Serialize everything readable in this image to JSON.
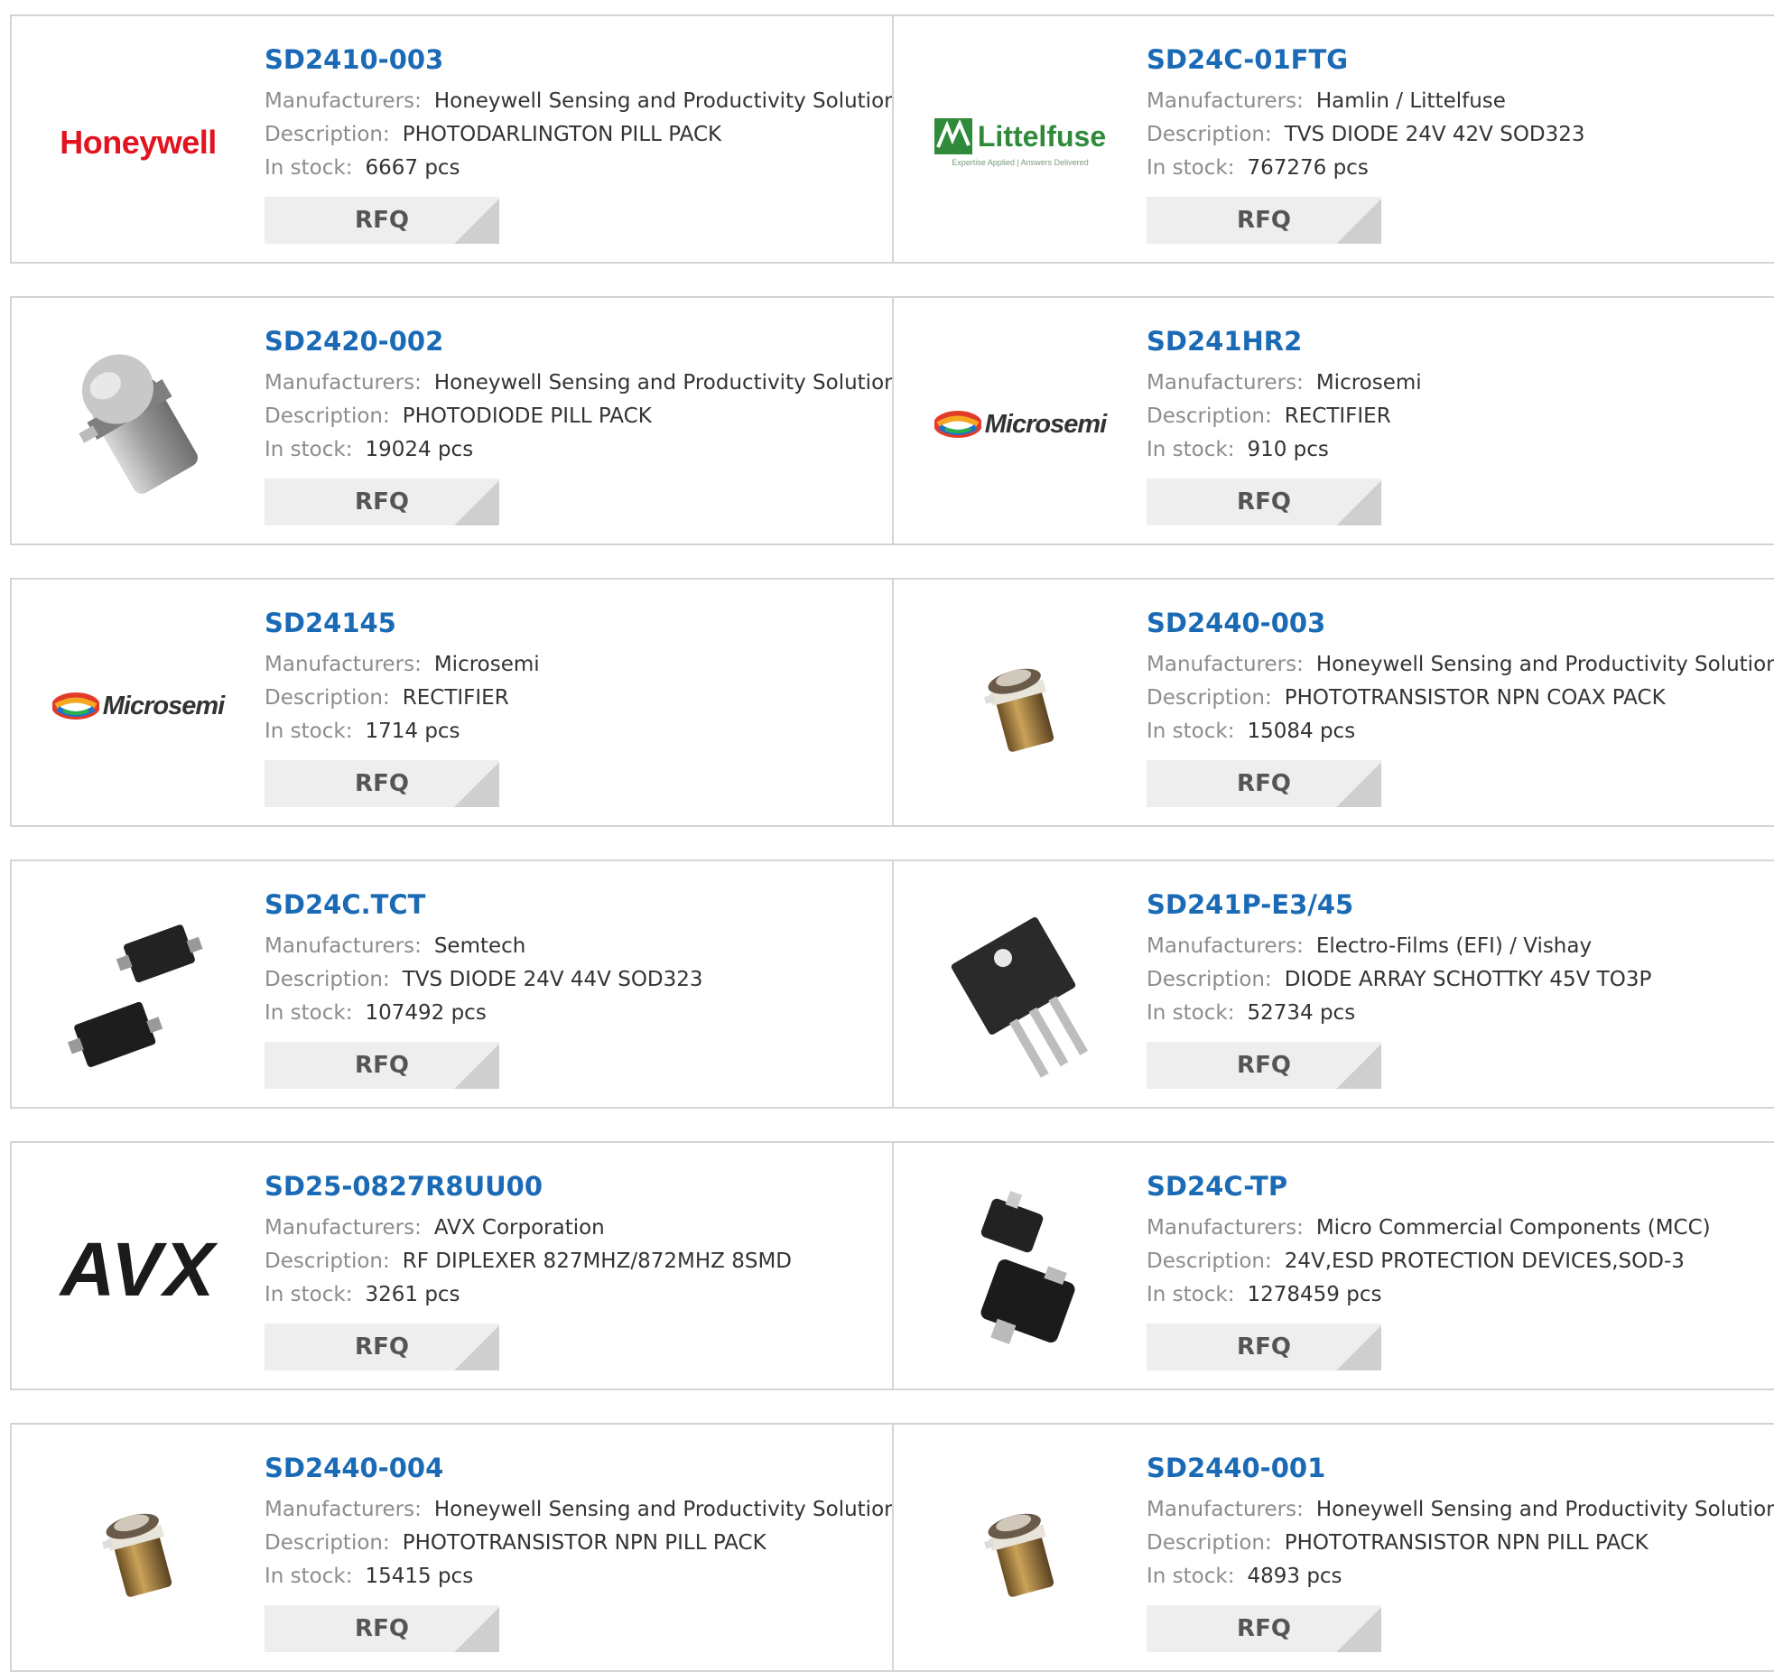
{
  "labels": {
    "manufacturers": "Manufacturers:",
    "description": "Description:",
    "in_stock": "In stock:",
    "rfq": "RFQ"
  },
  "colors": {
    "part_link": "#1a6ab5",
    "card_border": "#d4d4d4",
    "rfq_bg": "#eeeeee"
  },
  "products": [
    {
      "part": "SD2410-003",
      "manufacturer": "Honeywell Sensing and Productivity Solutions",
      "description": "PHOTODARLINGTON PILL PACK",
      "stock": "6667 pcs",
      "image": "honeywell-logo",
      "logo_text": "Honeywell"
    },
    {
      "part": "SD24C-01FTG",
      "manufacturer": "Hamlin / Littelfuse",
      "description": "TVS DIODE 24V 42V SOD323",
      "stock": "767276 pcs",
      "image": "littelfuse-logo",
      "logo_text": "Littelfuse",
      "logo_tagline": "Expertise Applied | Answers Delivered"
    },
    {
      "part": "SD2420-002",
      "manufacturer": "Honeywell Sensing and Productivity Solutions",
      "description": "PHOTODIODE PILL PACK",
      "stock": "19024 pcs",
      "image": "photodiode-photo"
    },
    {
      "part": "SD241HR2",
      "manufacturer": "Microsemi",
      "description": "RECTIFIER",
      "stock": "910 pcs",
      "image": "microsemi-logo",
      "logo_text": "Microsemi"
    },
    {
      "part": "SD24145",
      "manufacturer": "Microsemi",
      "description": "RECTIFIER",
      "stock": "1714 pcs",
      "image": "microsemi-logo",
      "logo_text": "Microsemi"
    },
    {
      "part": "SD2440-003",
      "manufacturer": "Honeywell Sensing and Productivity Solutions",
      "description": "PHOTOTRANSISTOR NPN COAX PACK",
      "stock": "15084 pcs",
      "image": "phototransistor-photo"
    },
    {
      "part": "SD24C.TCT",
      "manufacturer": "Semtech",
      "description": "TVS DIODE 24V 44V SOD323",
      "stock": "107492 pcs",
      "image": "sod323-photo"
    },
    {
      "part": "SD241P-E3/45",
      "manufacturer": "Electro-Films (EFI) / Vishay",
      "description": "DIODE ARRAY SCHOTTKY 45V TO3P",
      "stock": "52734 pcs",
      "image": "to3p-photo"
    },
    {
      "part": "SD25-0827R8UU00",
      "manufacturer": "AVX Corporation",
      "description": "RF DIPLEXER 827MHZ/872MHZ 8SMD",
      "stock": "3261 pcs",
      "image": "avx-logo",
      "logo_text": "AVX"
    },
    {
      "part": "SD24C-TP",
      "manufacturer": "Micro Commercial Components (MCC)",
      "description": "24V,ESD PROTECTION DEVICES,SOD-3",
      "stock": "1278459 pcs",
      "image": "sod3-photo"
    },
    {
      "part": "SD2440-004",
      "manufacturer": "Honeywell Sensing and Productivity Solutions",
      "description": "PHOTOTRANSISTOR NPN PILL PACK",
      "stock": "15415 pcs",
      "image": "phototransistor-photo"
    },
    {
      "part": "SD2440-001",
      "manufacturer": "Honeywell Sensing and Productivity Solutions",
      "description": "PHOTOTRANSISTOR NPN PILL PACK",
      "stock": "4893 pcs",
      "image": "phototransistor-photo"
    }
  ]
}
